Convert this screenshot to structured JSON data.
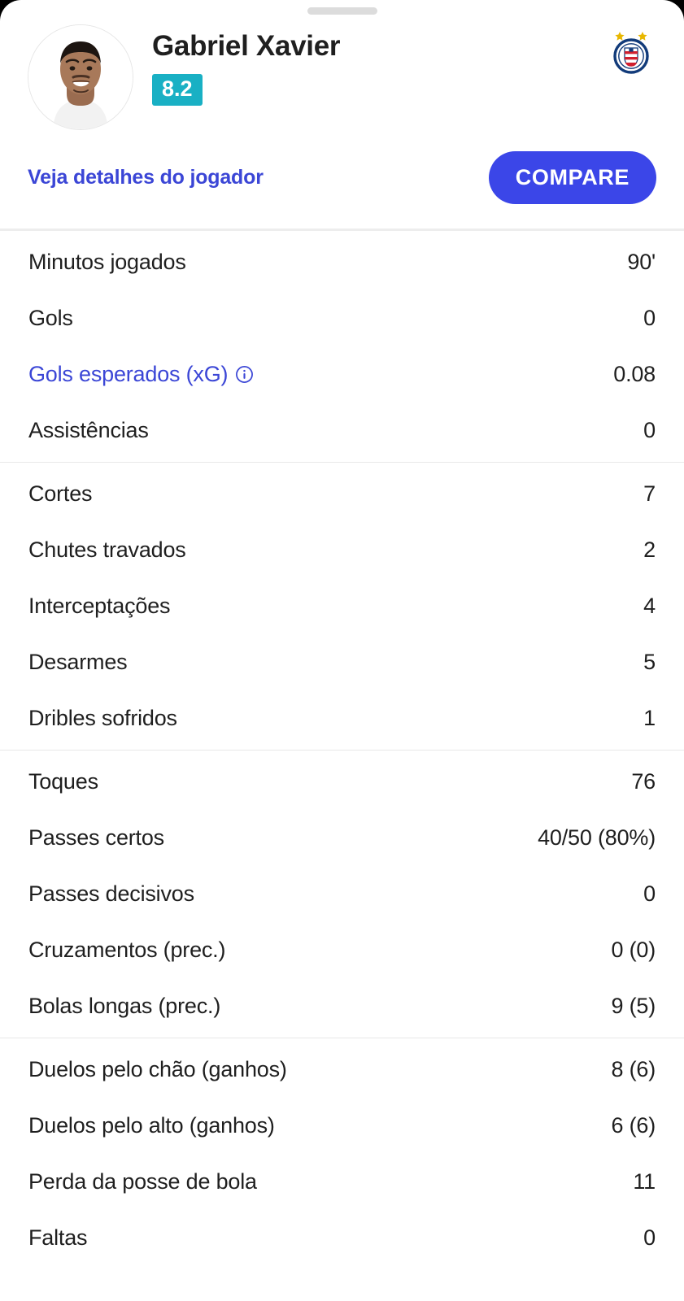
{
  "sheet": {
    "drag_handle_name": "drag-handle"
  },
  "header": {
    "player_name": "Gabriel Xavier",
    "rating": "8.2",
    "rating_color": "#19b0c4",
    "details_link": "Veja detalhes do jogador",
    "compare_button": "COMPARE",
    "compare_color": "#3b46e8",
    "link_color": "#3b46d6",
    "team_crest_name": "esporte-clube-bahia-crest",
    "avatar_name": "player-avatar"
  },
  "stat_groups": [
    {
      "group_name": "attacking-stats",
      "rows": [
        {
          "label": "Minutos jogados",
          "value": "90'",
          "is_link": false,
          "has_info": false
        },
        {
          "label": "Gols",
          "value": "0",
          "is_link": false,
          "has_info": false
        },
        {
          "label": "Gols esperados (xG)",
          "value": "0.08",
          "is_link": true,
          "has_info": true
        },
        {
          "label": "Assistências",
          "value": "0",
          "is_link": false,
          "has_info": false
        }
      ]
    },
    {
      "group_name": "defending-stats",
      "rows": [
        {
          "label": "Cortes",
          "value": "7",
          "is_link": false,
          "has_info": false
        },
        {
          "label": "Chutes travados",
          "value": "2",
          "is_link": false,
          "has_info": false
        },
        {
          "label": "Interceptações",
          "value": "4",
          "is_link": false,
          "has_info": false
        },
        {
          "label": "Desarmes",
          "value": "5",
          "is_link": false,
          "has_info": false
        },
        {
          "label": "Dribles sofridos",
          "value": "1",
          "is_link": false,
          "has_info": false
        }
      ]
    },
    {
      "group_name": "passing-stats",
      "rows": [
        {
          "label": "Toques",
          "value": "76",
          "is_link": false,
          "has_info": false
        },
        {
          "label": "Passes certos",
          "value": "40/50 (80%)",
          "is_link": false,
          "has_info": false
        },
        {
          "label": "Passes decisivos",
          "value": "0",
          "is_link": false,
          "has_info": false
        },
        {
          "label": "Cruzamentos (prec.)",
          "value": "0 (0)",
          "is_link": false,
          "has_info": false
        },
        {
          "label": "Bolas longas (prec.)",
          "value": "9 (5)",
          "is_link": false,
          "has_info": false
        }
      ]
    },
    {
      "group_name": "duels-stats",
      "rows": [
        {
          "label": "Duelos pelo chão (ganhos)",
          "value": "8 (6)",
          "is_link": false,
          "has_info": false
        },
        {
          "label": "Duelos pelo alto (ganhos)",
          "value": "6 (6)",
          "is_link": false,
          "has_info": false
        },
        {
          "label": "Perda da posse de bola",
          "value": "11",
          "is_link": false,
          "has_info": false
        },
        {
          "label": "Faltas",
          "value": "0",
          "is_link": false,
          "has_info": false
        }
      ]
    }
  ]
}
